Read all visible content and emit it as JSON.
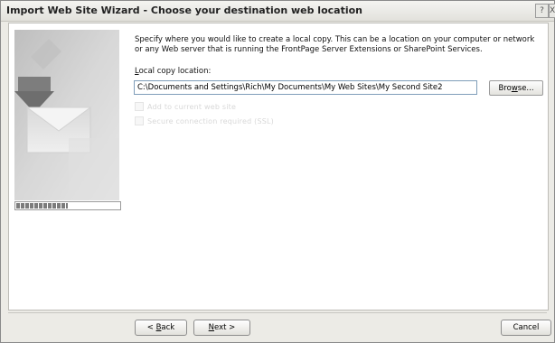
{
  "window": {
    "title": "Import Web Site Wizard - Choose your destination web location",
    "help_glyph": "?",
    "close_glyph": "X"
  },
  "instructions": "Specify where you would like to create a local copy.  This can be a location on your computer or network or any Web server that is running the FrontPage Server Extensions or SharePoint Services.",
  "location": {
    "label_hotkey": "L",
    "label_rest": "ocal copy location:",
    "value": "C:\\Documents and Settings\\Rich\\My Documents\\My Web Sites\\My Second Site2",
    "browse_hotkey": "w",
    "browse_prefix": "Bro",
    "browse_suffix": "se..."
  },
  "options": {
    "option1_label": "Add to current web site",
    "option2_label": "Secure connection required (SSL)"
  },
  "progress": {
    "fraction": 0.5
  },
  "footer": {
    "back_prefix": "< ",
    "back_hotkey": "B",
    "back_rest": "ack",
    "next_hotkey": "N",
    "next_rest": "ext >",
    "cancel_label": "Cancel"
  }
}
